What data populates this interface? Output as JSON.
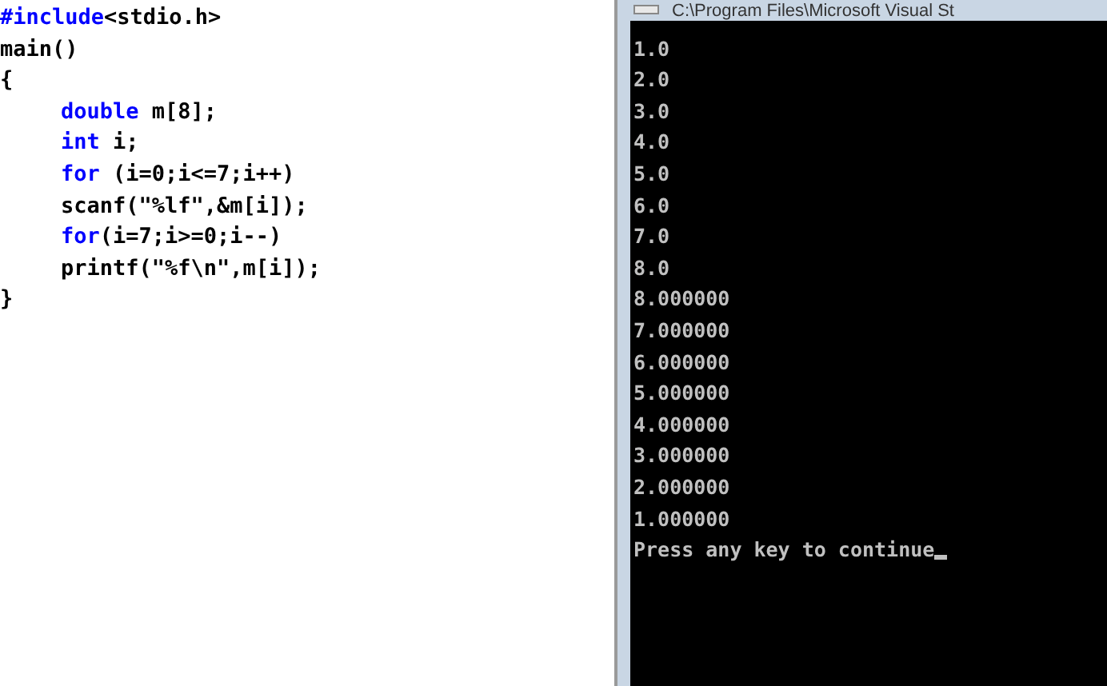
{
  "editor": {
    "lines": [
      {
        "indented": false,
        "tokens": [
          {
            "text": "#include",
            "kind": "keyword"
          },
          {
            "text": "<stdio.h>",
            "kind": "plain"
          }
        ]
      },
      {
        "indented": false,
        "tokens": [
          {
            "text": "main()",
            "kind": "plain"
          }
        ]
      },
      {
        "indented": false,
        "tokens": [
          {
            "text": "{",
            "kind": "plain"
          }
        ]
      },
      {
        "indented": true,
        "tokens": [
          {
            "text": "double",
            "kind": "keyword"
          },
          {
            "text": " m[8];",
            "kind": "plain"
          }
        ]
      },
      {
        "indented": true,
        "tokens": [
          {
            "text": "int",
            "kind": "keyword"
          },
          {
            "text": " i;",
            "kind": "plain"
          }
        ]
      },
      {
        "indented": true,
        "tokens": [
          {
            "text": "for",
            "kind": "keyword"
          },
          {
            "text": " (i=0;i<=7;i++)",
            "kind": "plain"
          }
        ]
      },
      {
        "indented": true,
        "tokens": [
          {
            "text": "scanf(\"%lf\",&m[i]);",
            "kind": "plain"
          }
        ]
      },
      {
        "indented": true,
        "tokens": [
          {
            "text": "for",
            "kind": "keyword"
          },
          {
            "text": "(i=7;i>=0;i--)",
            "kind": "plain"
          }
        ]
      },
      {
        "indented": true,
        "tokens": [
          {
            "text": "printf(\"%f\\n\",m[i]);",
            "kind": "plain"
          }
        ]
      },
      {
        "indented": false,
        "tokens": [
          {
            "text": "}",
            "kind": "plain"
          }
        ]
      }
    ]
  },
  "console": {
    "title": "C:\\Program Files\\Microsoft Visual St",
    "lines": [
      "1.0",
      "2.0",
      "3.0",
      "4.0",
      "5.0",
      "6.0",
      "7.0",
      "8.0",
      "8.000000",
      "7.000000",
      "6.000000",
      "5.000000",
      "4.000000",
      "3.000000",
      "2.000000",
      "1.000000",
      "Press any key to continue"
    ],
    "cursor": true
  }
}
